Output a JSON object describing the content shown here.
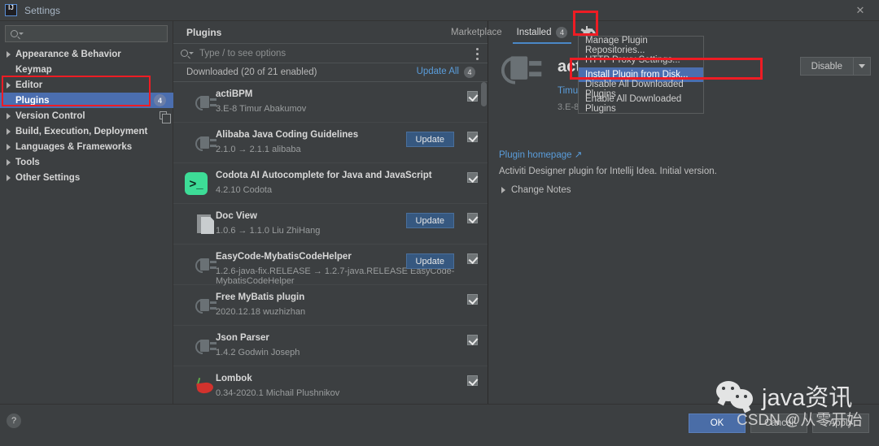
{
  "window": {
    "title": "Settings",
    "logo_icon": "intellij-idea-logo",
    "close_icon": "close-icon"
  },
  "sidebar": {
    "search": {
      "placeholder": "",
      "value": "",
      "icon": "search-icon"
    },
    "items": [
      {
        "label": "Appearance & Behavior",
        "expandable": true,
        "bold": true,
        "selected": false
      },
      {
        "label": "Keymap",
        "expandable": false,
        "bold": true,
        "selected": false
      },
      {
        "label": "Editor",
        "expandable": true,
        "bold": true,
        "selected": false
      },
      {
        "label": "Plugins",
        "expandable": false,
        "bold": true,
        "selected": true,
        "badge": "4"
      },
      {
        "label": "Version Control",
        "expandable": true,
        "bold": true,
        "selected": false,
        "trailing_icon": "copy-settings-icon"
      },
      {
        "label": "Build, Execution, Deployment",
        "expandable": true,
        "bold": true,
        "selected": false
      },
      {
        "label": "Languages & Frameworks",
        "expandable": true,
        "bold": true,
        "selected": false
      },
      {
        "label": "Tools",
        "expandable": true,
        "bold": true,
        "selected": false
      },
      {
        "label": "Other Settings",
        "expandable": true,
        "bold": true,
        "selected": false
      }
    ]
  },
  "plugins_panel": {
    "title": "Plugins",
    "search": {
      "placeholder": "Type / to see options",
      "value": "",
      "icon": "search-icon"
    },
    "options_icon": "kebab-menu-icon",
    "downloaded_label": "Downloaded (20 of 21 enabled)",
    "update_all_label": "Update All",
    "update_all_count": "4",
    "rows": [
      {
        "name": "actiBPM",
        "meta": "3.E-8  Timur Abakumov",
        "icon": "plug-icon",
        "button": null,
        "checked": true
      },
      {
        "name": "Alibaba Java Coding Guidelines",
        "meta": "2.1.0 → 2.1.1  alibaba",
        "icon": "plug-icon",
        "button": "Update",
        "checked": true
      },
      {
        "name": "Codota AI Autocomplete for Java and JavaScript",
        "meta": "4.2.10  Codota",
        "icon": "codota-icon",
        "button": null,
        "checked": true
      },
      {
        "name": "Doc View",
        "meta": "1.0.6 → 1.1.0  Liu ZhiHang",
        "icon": "document-icon",
        "button": "Update",
        "checked": true
      },
      {
        "name": "EasyCode-MybatisCodeHelper",
        "meta": "1.2.6-java-fix.RELEASE → 1.2.7-java.RELEASE  EasyCode-MybatisCodeHelper",
        "icon": "plug-icon",
        "button": "Update",
        "checked": true
      },
      {
        "name": "Free MyBatis plugin",
        "meta": "2020.12.18  wuzhizhan",
        "icon": "plug-icon",
        "button": null,
        "checked": true
      },
      {
        "name": "Json Parser",
        "meta": "1.4.2  Godwin Joseph",
        "icon": "plug-icon",
        "button": null,
        "checked": true
      },
      {
        "name": "Lombok",
        "meta": "0.34-2020.1  Michail    Plushnikov",
        "icon": "lombok-icon",
        "button": null,
        "checked": true
      }
    ]
  },
  "tabs": [
    {
      "label": "Marketplace",
      "active": false,
      "badge": null
    },
    {
      "label": "Installed",
      "active": true,
      "badge": "4"
    }
  ],
  "gear_icon": "gear-icon",
  "menu": {
    "items": [
      {
        "label": "Manage Plugin Repositories...",
        "selected": false
      },
      {
        "label": "HTTP Proxy Settings...",
        "selected": false
      },
      {
        "label": "Install Plugin from Disk...",
        "selected": true
      },
      {
        "label": "Disable All Downloaded Plugins",
        "selected": false
      },
      {
        "label": "Enable All Downloaded Plugins",
        "selected": false
      }
    ]
  },
  "detail": {
    "icon": "plug-icon",
    "title": "actiBPM",
    "author": "Timur Abakumov",
    "version": "3.E-8",
    "disable_button": "Disable",
    "dropdown_icon": "chevron-down-icon",
    "homepage_link": "Plugin homepage ↗",
    "description": "Activiti Designer plugin for Intellij Idea. Initial version.",
    "change_notes": "Change Notes"
  },
  "footer": {
    "help_label": "?",
    "ok_label": "OK",
    "cancel_label": "Cancel",
    "apply_label": "Apply"
  },
  "watermark": {
    "logo_icon": "wechat-logo-icon",
    "title": "java资讯",
    "subtitle": "CSDN @从零开始"
  },
  "colors": {
    "accent_blue": "#4b6eaf",
    "link_blue": "#5a9ddb",
    "annotation_red": "#ee1c24",
    "panel_bg": "#3c3f41",
    "codota_green": "#3ddc97"
  }
}
